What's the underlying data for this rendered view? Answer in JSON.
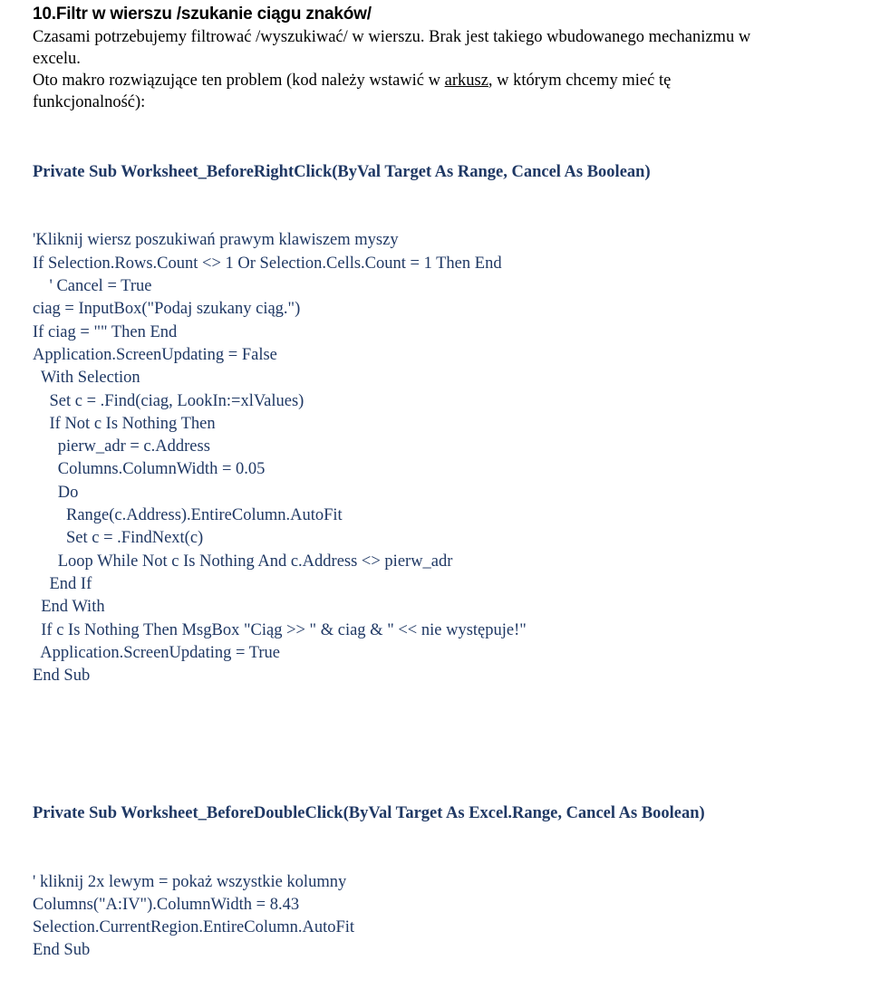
{
  "document": {
    "heading": "10.Filtr w wierszu /szukanie ciągu znaków/",
    "intro": {
      "line1_part1": "Czasami potrzebujemy filtrować /wyszukiwać/ w wierszu. Brak jest takiego wbudowanego mechanizmu w",
      "line2": "excelu.",
      "line3_part1": "Oto makro rozwiązujące ten problem (kod należy wstawić w ",
      "line3_link": "arkusz",
      "line3_part2": ", w którym chcemy mieć tę",
      "line4": "funkcjonalność):"
    },
    "code_block_1": {
      "header_bold": "Private Sub Worksheet_BeforeRightClick(ByVal Target As Range, Cancel As Boolean)",
      "lines": [
        "'Kliknij wiersz poszukiwań prawym klawiszem myszy",
        "If Selection.Rows.Count <> 1 Or Selection.Cells.Count = 1 Then End",
        "    ' Cancel = True",
        "ciag = InputBox(\"Podaj szukany ciąg.\")",
        "If ciag = \"\" Then End",
        "Application.ScreenUpdating = False",
        "  With Selection",
        "    Set c = .Find(ciag, LookIn:=xlValues)",
        "    If Not c Is Nothing Then",
        "      pierw_adr = c.Address",
        "      Columns.ColumnWidth = 0.05",
        "      Do",
        "        Range(c.Address).EntireColumn.AutoFit",
        "        Set c = .FindNext(c)",
        "      Loop While Not c Is Nothing And c.Address <> pierw_adr",
        "    End If",
        "  End With",
        "  If c Is Nothing Then MsgBox \"Ciąg >> \" & ciag & \" << nie występuje!\"",
        "  Application.ScreenUpdating = True",
        "End Sub"
      ]
    },
    "code_block_2": {
      "header_bold": "Private Sub Worksheet_BeforeDoubleClick(ByVal Target As Excel.Range, Cancel As Boolean)",
      "lines": [
        "' kliknij 2x lewym = pokaż wszystkie kolumny",
        "Columns(\"A:IV\").ColumnWidth = 8.43",
        "Selection.CurrentRegion.EntireColumn.AutoFit",
        "End Sub"
      ]
    },
    "colors": {
      "code": "#1f3864",
      "text": "#000000",
      "background": "#ffffff"
    }
  }
}
